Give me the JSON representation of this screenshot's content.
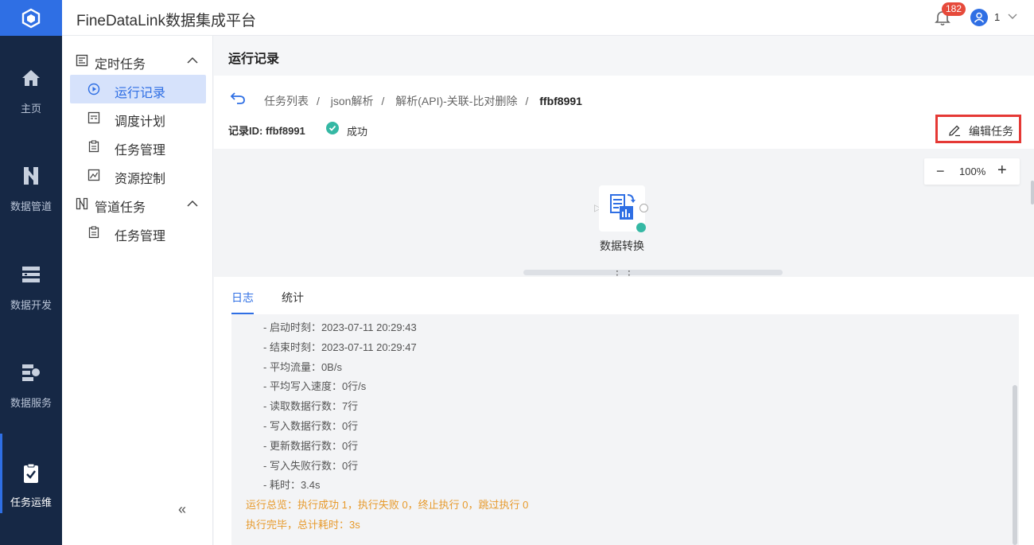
{
  "app": {
    "title": "FineDataLink数据集成平台"
  },
  "rail": {
    "items": [
      {
        "label": "主页",
        "icon": "home-icon"
      },
      {
        "label": "数据管道",
        "icon": "pipeline-icon"
      },
      {
        "label": "数据开发",
        "icon": "dev-icon"
      },
      {
        "label": "数据服务",
        "icon": "service-icon"
      },
      {
        "label": "任务运维",
        "icon": "clipboard-check-icon"
      }
    ]
  },
  "topbar": {
    "notifications": "182",
    "user": "1"
  },
  "sidebar": {
    "group1": "定时任务",
    "group1_items": [
      "运行记录",
      "调度计划",
      "任务管理",
      "资源控制"
    ],
    "group2": "管道任务",
    "group2_items": [
      "任务管理"
    ],
    "collapse": "«"
  },
  "page": {
    "title": "运行记录",
    "breadcrumb": [
      "任务列表",
      "json解析",
      "解析(API)-关联-比对删除",
      "ffbf8991"
    ],
    "record_id": "记录ID: ffbf8991",
    "status": "成功",
    "edit_button": "编辑任务"
  },
  "canvas": {
    "zoom": "100%",
    "node_label": "数据转换",
    "drag_handle": "⋮⋮"
  },
  "log": {
    "tabs": [
      "日志",
      "统计"
    ],
    "lines": [
      {
        "text": "- 启动时刻：2023-07-11 20:29:43",
        "warn": false
      },
      {
        "text": "- 结束时刻：2023-07-11 20:29:47",
        "warn": false
      },
      {
        "text": "- 平均流量：0B/s",
        "warn": false
      },
      {
        "text": "- 平均写入速度：0行/s",
        "warn": false
      },
      {
        "text": "- 读取数据行数：7行",
        "warn": false
      },
      {
        "text": "- 写入数据行数：0行",
        "warn": false
      },
      {
        "text": "- 更新数据行数：0行",
        "warn": false
      },
      {
        "text": "- 写入失败行数：0行",
        "warn": false
      },
      {
        "text": "- 耗时：3.4s",
        "warn": false
      },
      {
        "text": "运行总览：执行成功 1，执行失败 0，终止执行 0，跳过执行 0",
        "warn": true
      },
      {
        "text": "执行完毕，总计耗时：3s",
        "warn": true
      }
    ]
  },
  "colors": {
    "brand": "#2f6fe4",
    "rail": "#162845",
    "success": "#35b8a4",
    "warn": "#e79a2c",
    "highlight": "#e53935"
  }
}
